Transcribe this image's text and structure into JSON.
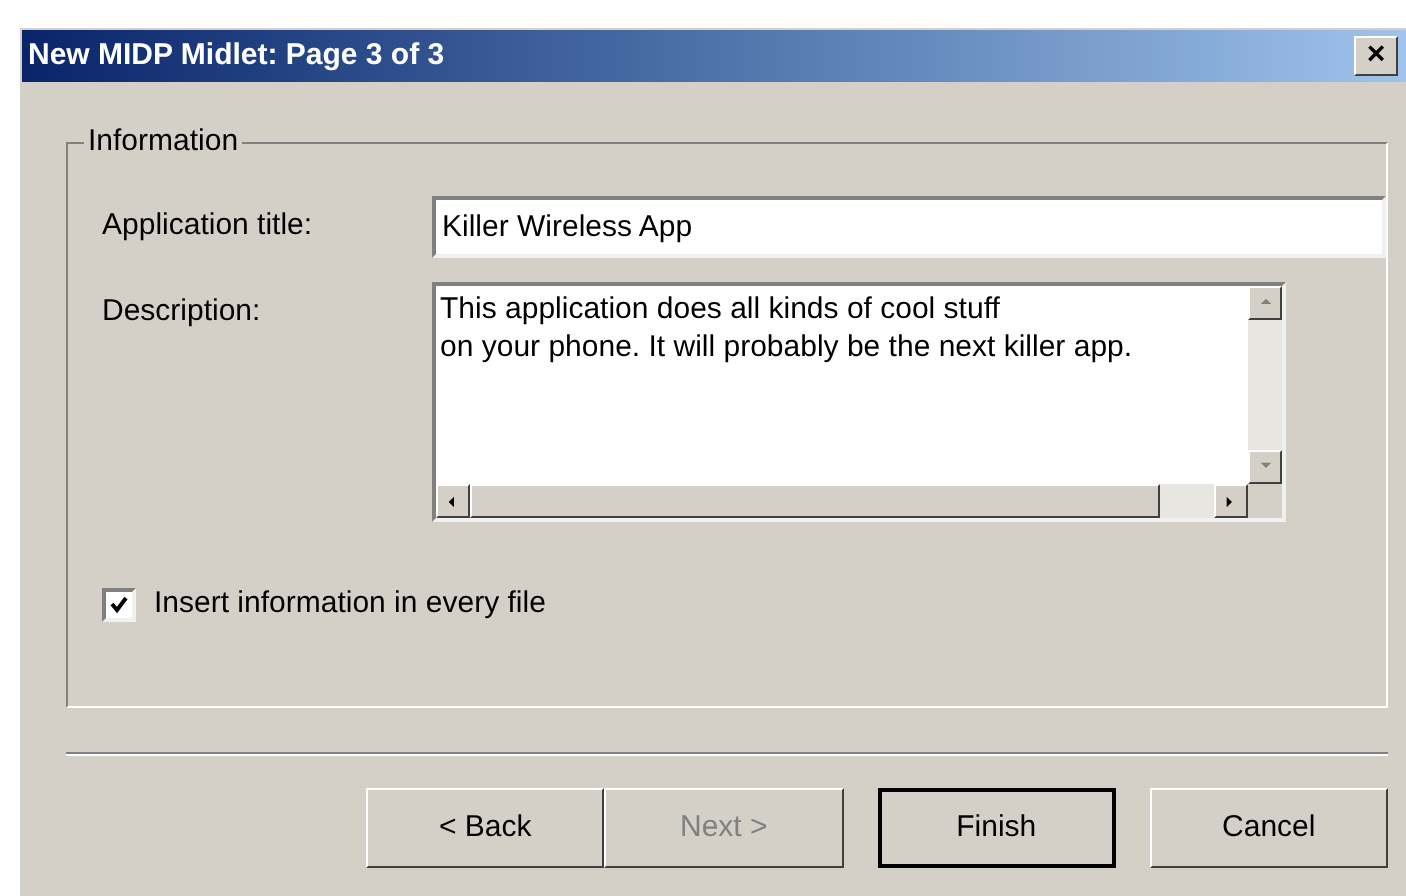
{
  "window": {
    "title": "New MIDP Midlet: Page 3 of 3",
    "close": "×"
  },
  "group": {
    "title": "Information",
    "fields": [
      {
        "kind": "line",
        "label": "Application title:",
        "value": "Killer Wireless App"
      },
      {
        "kind": "area",
        "label": "Description:",
        "value": "This application does all kinds of cool stuff\non your phone. It will probably be the next killer app."
      }
    ],
    "checkbox": {
      "label": "Insert information in every file",
      "checked": true
    }
  },
  "buttons": [
    {
      "label": "< Back",
      "disabled": false,
      "default": false
    },
    {
      "label": "Next >",
      "disabled": true,
      "default": false
    },
    {
      "label": "Finish",
      "disabled": false,
      "default": true
    },
    {
      "label": "Cancel",
      "disabled": false,
      "default": false
    }
  ]
}
